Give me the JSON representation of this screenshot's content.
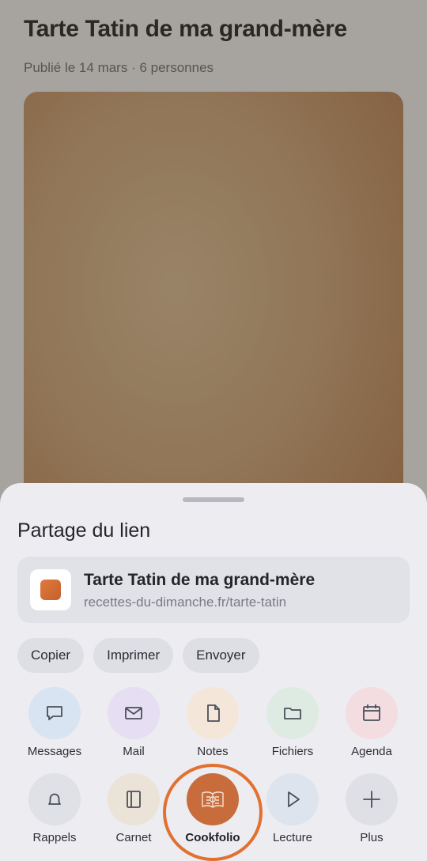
{
  "page": {
    "title": "Tarte Tatin de ma grand-mère",
    "meta": "Publié le 14 mars · 6 personnes"
  },
  "share_sheet": {
    "title": "Partage du lien",
    "preview": {
      "title": "Tarte Tatin de ma grand-mère",
      "url": "recettes-du-dimanche.fr/tarte-tatin"
    },
    "actions": [
      "Copier",
      "Imprimer",
      "Envoyer"
    ],
    "apps_row1": [
      {
        "label": "Messages",
        "icon": "chat-bubble-icon",
        "color": "#d9e4f3"
      },
      {
        "label": "Mail",
        "icon": "envelope-icon",
        "color": "#e6def2"
      },
      {
        "label": "Notes",
        "icon": "document-icon",
        "color": "#f5e6da"
      },
      {
        "label": "Fichiers",
        "icon": "folder-icon",
        "color": "#deebe2"
      },
      {
        "label": "Agenda",
        "icon": "calendar-icon",
        "color": "#f3dde1"
      }
    ],
    "apps_row2": [
      {
        "label": "Rappels",
        "icon": "bell-icon",
        "color": "#dfe1e6"
      },
      {
        "label": "Carnet",
        "icon": "notebook-icon",
        "color": "#ebe3d8"
      },
      {
        "label": "Cookfolio",
        "icon": "cookbook-icon",
        "color": "#c86c3c"
      },
      {
        "label": "Lecture",
        "icon": "play-icon",
        "color": "#dde4ee"
      },
      {
        "label": "Plus",
        "icon": "plus-icon",
        "color": "#dfe0e6"
      }
    ],
    "highlight_color": "#e2702f"
  }
}
